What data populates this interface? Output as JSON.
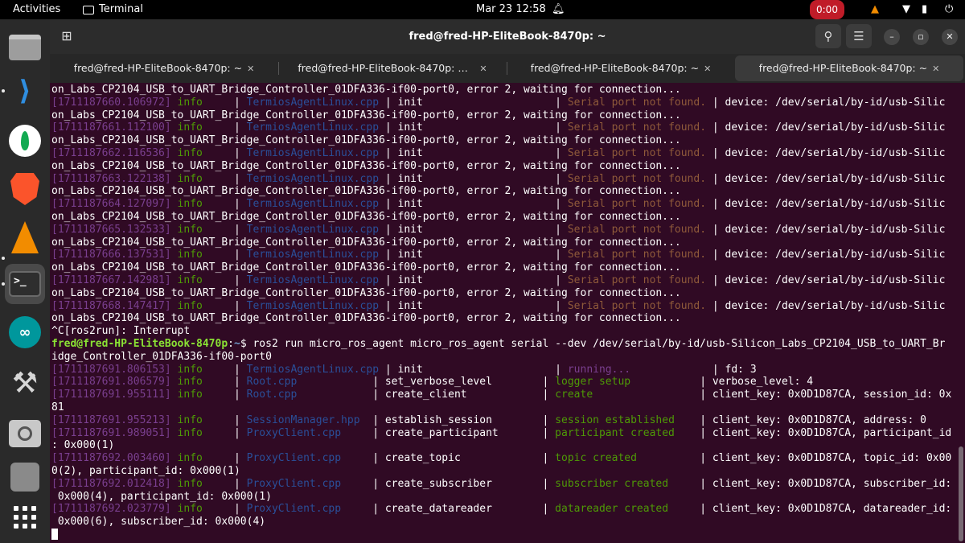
{
  "topbar": {
    "activities": "Activities",
    "app": "Terminal",
    "clock": "Mar 23  12:58",
    "rec": "0:00"
  },
  "dock": {
    "items": [
      "files-icon",
      "vscode-icon",
      "mongodb-icon",
      "brave-icon",
      "vlc-icon",
      "terminal-icon",
      "arduino-icon",
      "tools-icon",
      "image-viewer-icon",
      "disk-icon",
      "app-grid-icon"
    ]
  },
  "window": {
    "title": "fred@fred-HP-EliteBook-8470p: ~",
    "tabs": [
      {
        "label": "fred@fred-HP-EliteBook-8470p: ~"
      },
      {
        "label": "fred@fred-HP-EliteBook-8470p: ~/r..."
      },
      {
        "label": "fred@fred-HP-EliteBook-8470p: ~"
      },
      {
        "label": "fred@fred-HP-EliteBook-8470p: ~"
      }
    ]
  },
  "terminal": {
    "lines": [
      [
        {
          "t": "on_Labs_CP2104_USB_to_UART_Bridge_Controller_01DFA336-if00-port0, error 2, waiting for connection..."
        }
      ],
      [
        {
          "t": "[1711187660.106972] ",
          "c": "ts"
        },
        {
          "t": "info",
          "c": "lvl"
        },
        {
          "t": "     | "
        },
        {
          "t": "TermiosAgentLinux.cpp",
          "c": "file"
        },
        {
          "t": " | init                     | "
        },
        {
          "t": "Serial port not found.",
          "c": "warn"
        },
        {
          "t": " | device: /dev/serial/by-id/usb-Silic"
        }
      ],
      [
        {
          "t": "on_Labs_CP2104_USB_to_UART_Bridge_Controller_01DFA336-if00-port0, error 2, waiting for connection..."
        }
      ],
      [
        {
          "t": "[1711187661.112100] ",
          "c": "ts"
        },
        {
          "t": "info",
          "c": "lvl"
        },
        {
          "t": "     | "
        },
        {
          "t": "TermiosAgentLinux.cpp",
          "c": "file"
        },
        {
          "t": " | init                     | "
        },
        {
          "t": "Serial port not found.",
          "c": "warn"
        },
        {
          "t": " | device: /dev/serial/by-id/usb-Silic"
        }
      ],
      [
        {
          "t": "on_Labs_CP2104_USB_to_UART_Bridge_Controller_01DFA336-if00-port0, error 2, waiting for connection..."
        }
      ],
      [
        {
          "t": "[1711187662.116536] ",
          "c": "ts"
        },
        {
          "t": "info",
          "c": "lvl"
        },
        {
          "t": "     | "
        },
        {
          "t": "TermiosAgentLinux.cpp",
          "c": "file"
        },
        {
          "t": " | init                     | "
        },
        {
          "t": "Serial port not found.",
          "c": "warn"
        },
        {
          "t": " | device: /dev/serial/by-id/usb-Silic"
        }
      ],
      [
        {
          "t": "on_Labs_CP2104_USB_to_UART_Bridge_Controller_01DFA336-if00-port0, error 2, waiting for connection..."
        }
      ],
      [
        {
          "t": "[1711187663.122138] ",
          "c": "ts"
        },
        {
          "t": "info",
          "c": "lvl"
        },
        {
          "t": "     | "
        },
        {
          "t": "TermiosAgentLinux.cpp",
          "c": "file"
        },
        {
          "t": " | init                     | "
        },
        {
          "t": "Serial port not found.",
          "c": "warn"
        },
        {
          "t": " | device: /dev/serial/by-id/usb-Silic"
        }
      ],
      [
        {
          "t": "on_Labs_CP2104_USB_to_UART_Bridge_Controller_01DFA336-if00-port0, error 2, waiting for connection..."
        }
      ],
      [
        {
          "t": "[1711187664.127097] ",
          "c": "ts"
        },
        {
          "t": "info",
          "c": "lvl"
        },
        {
          "t": "     | "
        },
        {
          "t": "TermiosAgentLinux.cpp",
          "c": "file"
        },
        {
          "t": " | init                     | "
        },
        {
          "t": "Serial port not found.",
          "c": "warn"
        },
        {
          "t": " | device: /dev/serial/by-id/usb-Silic"
        }
      ],
      [
        {
          "t": "on_Labs_CP2104_USB_to_UART_Bridge_Controller_01DFA336-if00-port0, error 2, waiting for connection..."
        }
      ],
      [
        {
          "t": "[1711187665.132533] ",
          "c": "ts"
        },
        {
          "t": "info",
          "c": "lvl"
        },
        {
          "t": "     | "
        },
        {
          "t": "TermiosAgentLinux.cpp",
          "c": "file"
        },
        {
          "t": " | init                     | "
        },
        {
          "t": "Serial port not found.",
          "c": "warn"
        },
        {
          "t": " | device: /dev/serial/by-id/usb-Silic"
        }
      ],
      [
        {
          "t": "on_Labs_CP2104_USB_to_UART_Bridge_Controller_01DFA336-if00-port0, error 2, waiting for connection..."
        }
      ],
      [
        {
          "t": "[1711187666.137531] ",
          "c": "ts"
        },
        {
          "t": "info",
          "c": "lvl"
        },
        {
          "t": "     | "
        },
        {
          "t": "TermiosAgentLinux.cpp",
          "c": "file"
        },
        {
          "t": " | init                     | "
        },
        {
          "t": "Serial port not found.",
          "c": "warn"
        },
        {
          "t": " | device: /dev/serial/by-id/usb-Silic"
        }
      ],
      [
        {
          "t": "on_Labs_CP2104_USB_to_UART_Bridge_Controller_01DFA336-if00-port0, error 2, waiting for connection..."
        }
      ],
      [
        {
          "t": "[1711187667.142981] ",
          "c": "ts"
        },
        {
          "t": "info",
          "c": "lvl"
        },
        {
          "t": "     | "
        },
        {
          "t": "TermiosAgentLinux.cpp",
          "c": "file"
        },
        {
          "t": " | init                     | "
        },
        {
          "t": "Serial port not found.",
          "c": "warn"
        },
        {
          "t": " | device: /dev/serial/by-id/usb-Silic"
        }
      ],
      [
        {
          "t": "on_Labs_CP2104_USB_to_UART_Bridge_Controller_01DFA336-if00-port0, error 2, waiting for connection..."
        }
      ],
      [
        {
          "t": "[1711187668.147417] ",
          "c": "ts"
        },
        {
          "t": "info",
          "c": "lvl"
        },
        {
          "t": "     | "
        },
        {
          "t": "TermiosAgentLinux.cpp",
          "c": "file"
        },
        {
          "t": " | init                     | "
        },
        {
          "t": "Serial port not found.",
          "c": "warn"
        },
        {
          "t": " | device: /dev/serial/by-id/usb-Silic"
        }
      ],
      [
        {
          "t": "on_Labs_CP2104_USB_to_UART_Bridge_Controller_01DFA336-if00-port0, error 2, waiting for connection..."
        }
      ],
      [
        {
          "t": "^C[ros2run]: Interrupt"
        }
      ],
      [
        {
          "t": "fred@fred-HP-EliteBook-8470p",
          "c": "prompt"
        },
        {
          "t": ":"
        },
        {
          "t": "~",
          "c": "path"
        },
        {
          "t": "$ ros2 run micro_ros_agent micro_ros_agent serial --dev /dev/serial/by-id/usb-Silicon_Labs_CP2104_USB_to_UART_Br"
        }
      ],
      [
        {
          "t": "idge_Controller_01DFA336-if00-port0"
        }
      ],
      [
        {
          "t": "[1711187691.806153] ",
          "c": "ts"
        },
        {
          "t": "info",
          "c": "lvl"
        },
        {
          "t": "     | "
        },
        {
          "t": "TermiosAgentLinux.cpp",
          "c": "file"
        },
        {
          "t": " | init                     | "
        },
        {
          "t": "running...",
          "c": "dim"
        },
        {
          "t": "             | fd: 3"
        }
      ],
      [
        {
          "t": "[1711187691.806579] ",
          "c": "ts"
        },
        {
          "t": "info",
          "c": "lvl"
        },
        {
          "t": "     | "
        },
        {
          "t": "Root.cpp",
          "c": "file"
        },
        {
          "t": "            | set_verbose_level        | "
        },
        {
          "t": "logger setup",
          "c": "green"
        },
        {
          "t": "           | verbose_level: 4"
        }
      ],
      [
        {
          "t": "[1711187691.955111] ",
          "c": "ts"
        },
        {
          "t": "info",
          "c": "lvl"
        },
        {
          "t": "     | "
        },
        {
          "t": "Root.cpp",
          "c": "file"
        },
        {
          "t": "            | create_client            | "
        },
        {
          "t": "create",
          "c": "green"
        },
        {
          "t": "                 | client_key: 0x0D1D87CA, session_id: 0x"
        }
      ],
      [
        {
          "t": "81"
        }
      ],
      [
        {
          "t": "[1711187691.955213] ",
          "c": "ts"
        },
        {
          "t": "info",
          "c": "lvl"
        },
        {
          "t": "     | "
        },
        {
          "t": "SessionManager.hpp",
          "c": "file"
        },
        {
          "t": "  | establish_session        | "
        },
        {
          "t": "session established",
          "c": "green"
        },
        {
          "t": "    | client_key: 0x0D1D87CA, address: 0"
        }
      ],
      [
        {
          "t": "[1711187691.989051] ",
          "c": "ts"
        },
        {
          "t": "info",
          "c": "lvl"
        },
        {
          "t": "     | "
        },
        {
          "t": "ProxyClient.cpp",
          "c": "file"
        },
        {
          "t": "     | create_participant       | "
        },
        {
          "t": "participant created",
          "c": "green"
        },
        {
          "t": "    | client_key: 0x0D1D87CA, participant_id"
        }
      ],
      [
        {
          "t": ": 0x000(1)"
        }
      ],
      [
        {
          "t": "[1711187692.003460] ",
          "c": "ts"
        },
        {
          "t": "info",
          "c": "lvl"
        },
        {
          "t": "     | "
        },
        {
          "t": "ProxyClient.cpp",
          "c": "file"
        },
        {
          "t": "     | create_topic             | "
        },
        {
          "t": "topic created",
          "c": "green"
        },
        {
          "t": "          | client_key: 0x0D1D87CA, topic_id: 0x00"
        }
      ],
      [
        {
          "t": "0(2), participant_id: 0x000(1)"
        }
      ],
      [
        {
          "t": "[1711187692.012418] ",
          "c": "ts"
        },
        {
          "t": "info",
          "c": "lvl"
        },
        {
          "t": "     | "
        },
        {
          "t": "ProxyClient.cpp",
          "c": "file"
        },
        {
          "t": "     | create_subscriber        | "
        },
        {
          "t": "subscriber created",
          "c": "green"
        },
        {
          "t": "     | client_key: 0x0D1D87CA, subscriber_id:"
        }
      ],
      [
        {
          "t": " 0x000(4), participant_id: 0x000(1)"
        }
      ],
      [
        {
          "t": "[1711187692.023779] ",
          "c": "ts"
        },
        {
          "t": "info",
          "c": "lvl"
        },
        {
          "t": "     | "
        },
        {
          "t": "ProxyClient.cpp",
          "c": "file"
        },
        {
          "t": "     | create_datareader        | "
        },
        {
          "t": "datareader created",
          "c": "green"
        },
        {
          "t": "     | client_key: 0x0D1D87CA, datareader_id:"
        }
      ],
      [
        {
          "t": " 0x000(6), subscriber_id: 0x000(4)"
        }
      ]
    ]
  }
}
